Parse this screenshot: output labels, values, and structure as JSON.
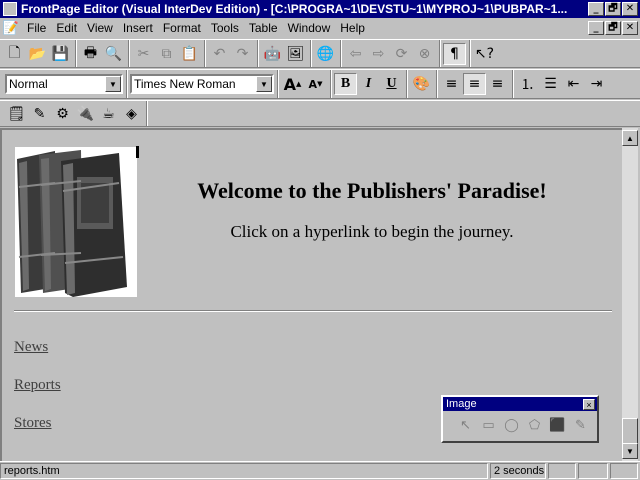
{
  "window": {
    "title": "FrontPage Editor (Visual InterDev Edition) - [C:\\PROGRA~1\\DEVSTU~1\\MYPROJ~1\\PUBPAR~1...",
    "controls": {
      "minimize": "_",
      "restore": "🗗",
      "close": "✕"
    }
  },
  "menubar": {
    "items": [
      "File",
      "Edit",
      "View",
      "Insert",
      "Format",
      "Tools",
      "Table",
      "Window",
      "Help"
    ]
  },
  "toolbar_standard": {
    "buttons": [
      "new-icon",
      "open-icon",
      "save-icon",
      "print-icon",
      "print-preview-icon",
      "cut-icon",
      "copy-icon",
      "paste-icon",
      "undo-icon",
      "redo-icon",
      "insert-webbot-icon",
      "insert-image-icon",
      "hyperlink-icon",
      "back-icon",
      "forward-icon",
      "refresh-icon",
      "stop-icon",
      "show-all-icon",
      "help-icon"
    ]
  },
  "toolbar_format": {
    "style_value": "Normal",
    "font_value": "Times New Roman",
    "increase_size": "A",
    "decrease_size": "A",
    "bold": "B",
    "italic": "I",
    "underline": "U"
  },
  "page": {
    "heading": "Welcome to the Publishers' Paradise!",
    "subheading": "Click on a hyperlink to begin the journey.",
    "links": [
      "News",
      "Reports",
      "Stores"
    ]
  },
  "image_palette": {
    "title": "Image",
    "close": "×"
  },
  "statusbar": {
    "file": "reports.htm",
    "time": "2 seconds"
  },
  "colors": {
    "titlebar": "#000080",
    "face": "#c0c0c0"
  }
}
